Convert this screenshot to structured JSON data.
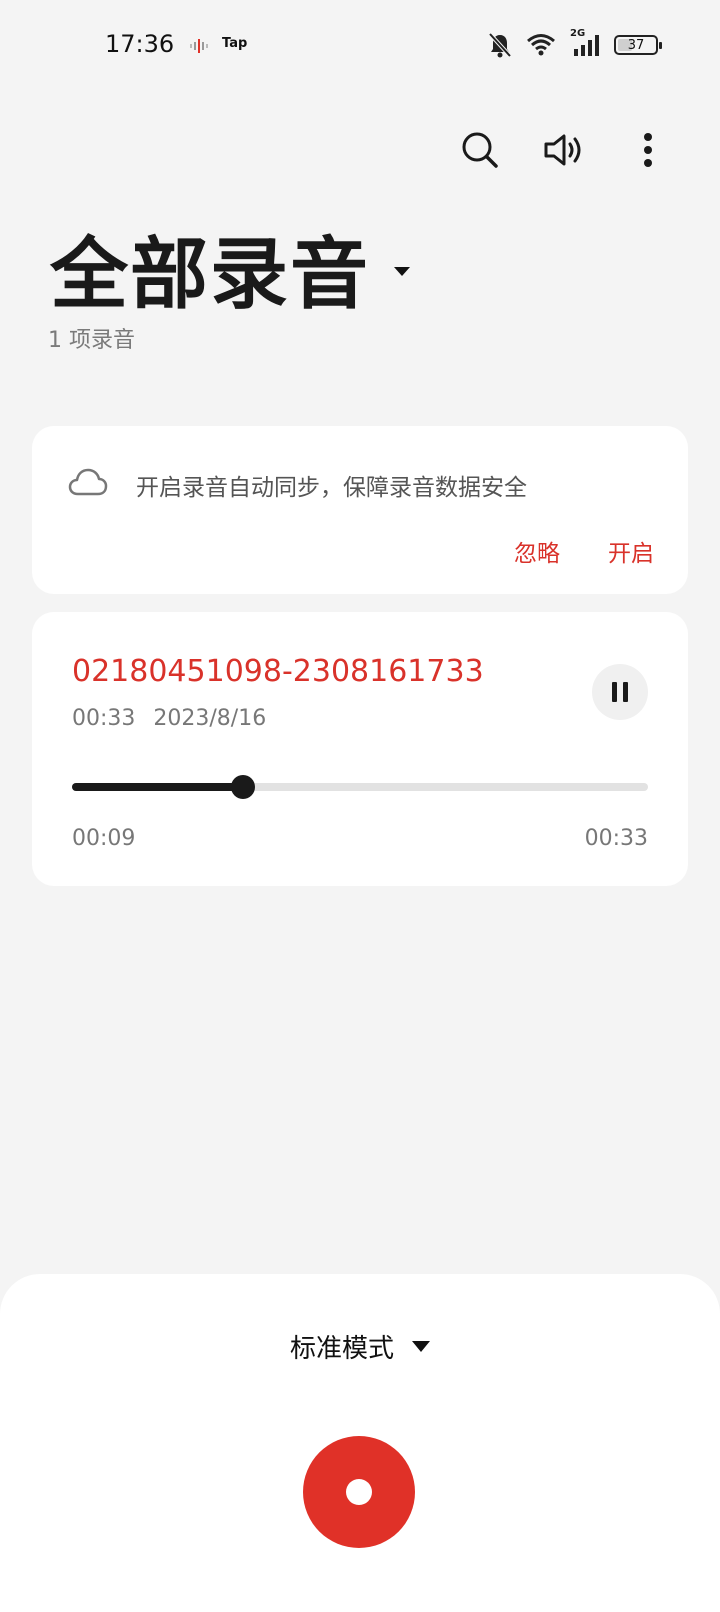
{
  "status_bar": {
    "time": "17:36",
    "app_label": "Tap",
    "network_label": "2G",
    "battery": "37",
    "icons": [
      "waveform-icon",
      "bell-off-icon",
      "wifi-icon",
      "signal-icon",
      "battery-icon"
    ]
  },
  "toolbar": {
    "icons": [
      "search-icon",
      "speaker-icon",
      "more-vertical-icon"
    ]
  },
  "header": {
    "title": "全部录音",
    "subtitle": "1 项录音"
  },
  "sync_card": {
    "icon": "cloud-icon",
    "message": "开启录音自动同步，保障录音数据安全",
    "ignore_label": "忽略",
    "enable_label": "开启"
  },
  "recording": {
    "name": "02180451098-2308161733",
    "duration": "00:33",
    "date": "2023/8/16",
    "current_time": "00:09",
    "total_time": "00:33",
    "progress": 0.297
  },
  "bottom_panel": {
    "mode_label": "标准模式",
    "record_icon": "record-icon"
  },
  "colors": {
    "accent": "#d9322a",
    "record": "#e03128",
    "background": "#f4f4f4",
    "card": "#ffffff"
  }
}
